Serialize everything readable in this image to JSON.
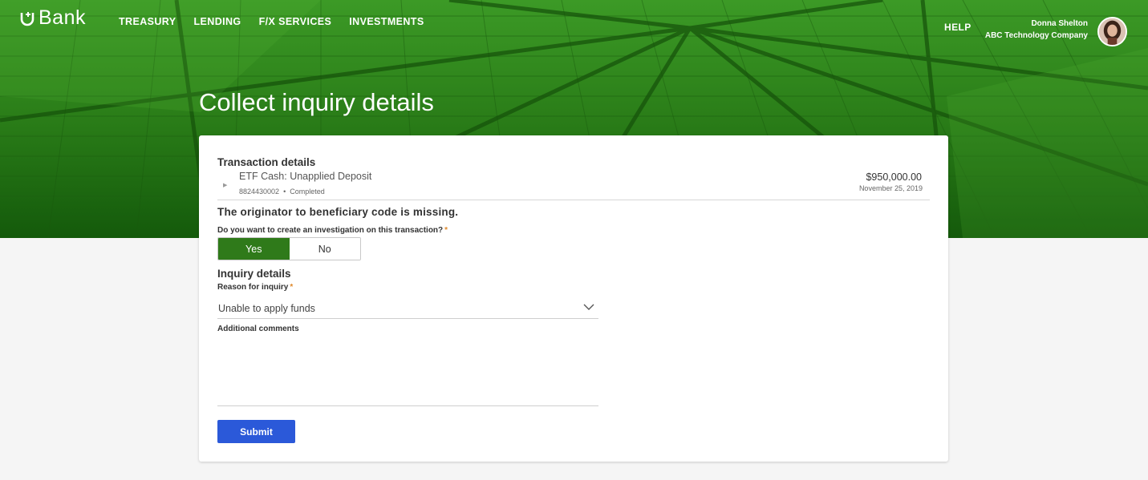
{
  "brand": {
    "logo_text": "Bank",
    "accent": "#2f7a1a",
    "button_color": "#2b59d9"
  },
  "nav": {
    "items": [
      "TREASURY",
      "LENDING",
      "F/X SERVICES",
      "INVESTMENTS"
    ],
    "help": "HELP"
  },
  "user": {
    "name": "Donna Shelton",
    "company": "ABC Technology Company"
  },
  "page": {
    "title": "Collect inquiry details"
  },
  "transaction": {
    "section_title": "Transaction details",
    "name": "ETF Cash:  Unapplied Deposit",
    "id": "8824430002",
    "separator": "•",
    "status": "Completed",
    "amount": "$950,000.00",
    "date": "November 25, 2019"
  },
  "warning": "The originator to beneficiary code is missing.",
  "investigation": {
    "question": "Do you want to create an investigation on this transaction?",
    "required_mark": "*",
    "yes": "Yes",
    "no": "No",
    "selected": "Yes"
  },
  "inquiry": {
    "section_title": "Inquiry details",
    "reason_label": "Reason for inquiry",
    "required_mark": "*",
    "reason_value": "Unable to apply funds",
    "comments_label": "Additional comments",
    "comments_value": ""
  },
  "actions": {
    "submit": "Submit"
  }
}
